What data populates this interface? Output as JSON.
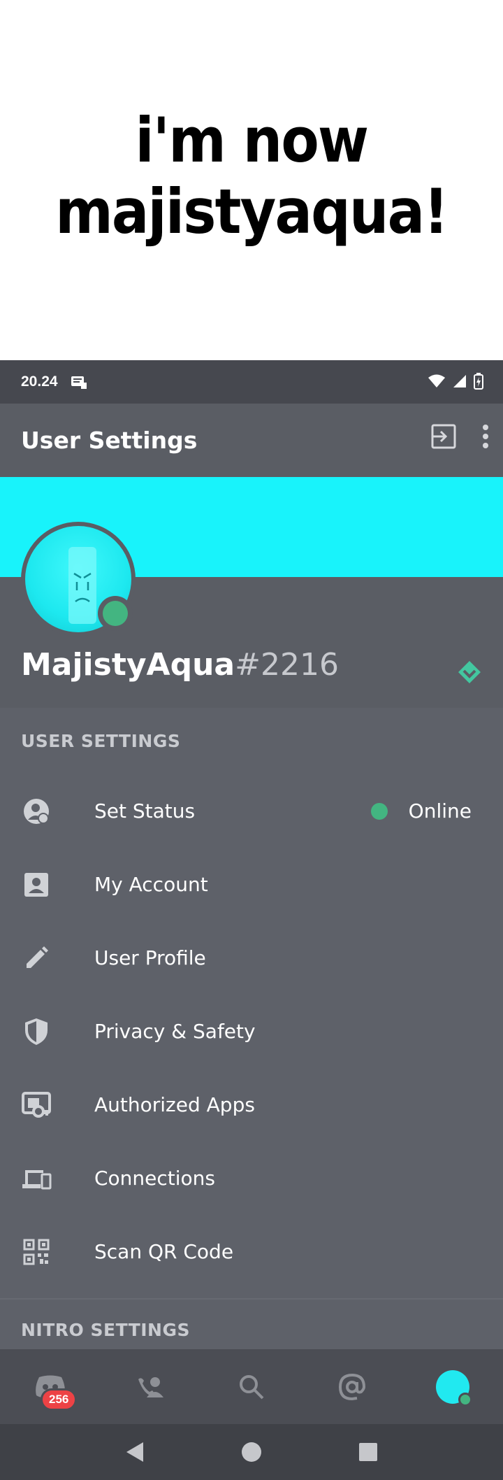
{
  "caption": {
    "text": "i'm now\nmajistyaqua!"
  },
  "status_bar": {
    "time": "20.24"
  },
  "app_bar": {
    "title": "User Settings"
  },
  "profile": {
    "name": "MajistyAqua",
    "discriminator": "#2216",
    "banner_color": "#18f3fb",
    "status_color": "#43b581"
  },
  "user_settings": {
    "header": "USER SETTINGS",
    "items": [
      {
        "label": "Set Status",
        "icon": "status-icon",
        "right_label": "Online"
      },
      {
        "label": "My Account",
        "icon": "account-icon"
      },
      {
        "label": "User Profile",
        "icon": "pencil-icon"
      },
      {
        "label": "Privacy & Safety",
        "icon": "shield-icon"
      },
      {
        "label": "Authorized Apps",
        "icon": "apps-key-icon"
      },
      {
        "label": "Connections",
        "icon": "devices-icon"
      },
      {
        "label": "Scan QR Code",
        "icon": "qr-code-icon"
      }
    ]
  },
  "nitro_settings": {
    "header": "NITRO SETTINGS"
  },
  "bottom_nav": {
    "home_badge": "256",
    "items": [
      "home-icon",
      "friends-icon",
      "search-icon",
      "mentions-icon",
      "profile-avatar"
    ]
  }
}
